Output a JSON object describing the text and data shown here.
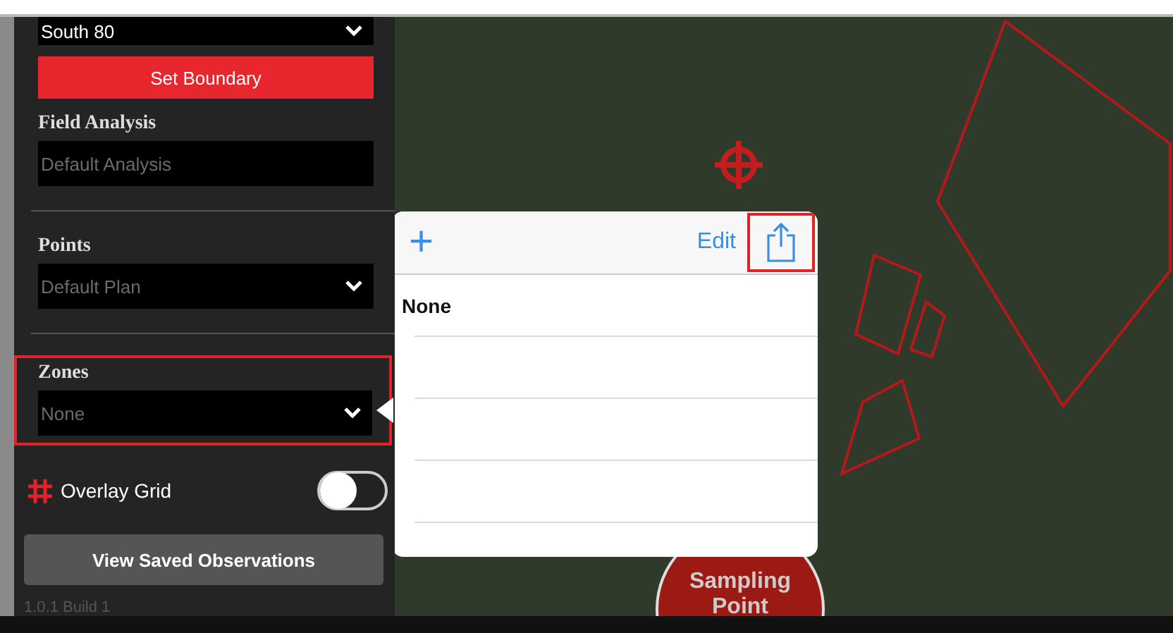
{
  "sidebar": {
    "farm_select": {
      "value": "South 80"
    },
    "set_boundary_button": "Set Boundary",
    "field_analysis": {
      "label": "Field Analysis",
      "placeholder": "Default Analysis"
    },
    "points": {
      "label": "Points",
      "value": "Default Plan"
    },
    "zones": {
      "label": "Zones",
      "value": "None",
      "highlighted": true
    },
    "overlay_grid": {
      "label": "Overlay Grid",
      "on": false
    },
    "view_saved_button": "View Saved Observations",
    "version": "1.0.1 Build 1"
  },
  "popover": {
    "add_button": "+",
    "edit_button": "Edit",
    "share_highlighted": true,
    "rows": [
      {
        "label": "None"
      },
      {
        "label": ""
      },
      {
        "label": ""
      },
      {
        "label": ""
      }
    ]
  },
  "map": {
    "drop_button": "Sampling Point"
  }
}
